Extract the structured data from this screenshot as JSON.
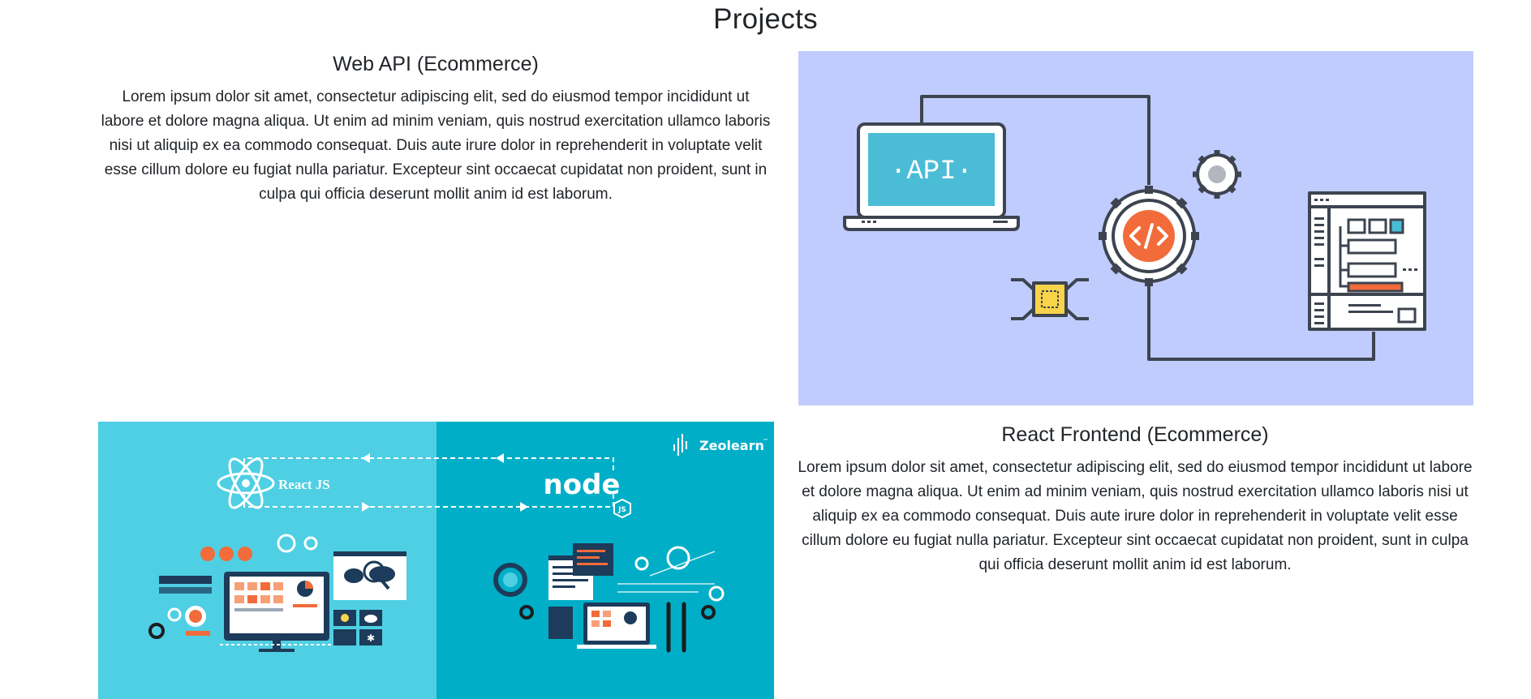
{
  "page": {
    "title": "Projects"
  },
  "projects": [
    {
      "title": "Web API (Ecommerce)",
      "description": "Lorem ipsum dolor sit amet, consectetur adipiscing elit, sed do eiusmod tempor incididunt ut labore et dolore magna aliqua. Ut enim ad minim veniam, quis nostrud exercitation ullamco laboris nisi ut aliquip ex ea commodo consequat. Duis aute irure dolor in reprehenderit in voluptate velit esse cillum dolore eu fugiat nulla pariatur. Excepteur sint occaecat cupidatat non proident, sunt in culpa qui officia deserunt mollit anim id est laborum.",
      "image_text": {
        "api": "·API·"
      }
    },
    {
      "title": "React Frontend (Ecommerce)",
      "description": "Lorem ipsum dolor sit amet, consectetur adipiscing elit, sed do eiusmod tempor incididunt ut labore et dolore magna aliqua. Ut enim ad minim veniam, quis nostrud exercitation ullamco laboris nisi ut aliquip ex ea commodo consequat. Duis aute irure dolor in reprehenderit in voluptate velit esse cillum dolore eu fugiat nulla pariatur. Excepteur sint occaecat cupidatat non proident, sunt in culpa qui officia deserunt mollit anim id est laborum.",
      "image_text": {
        "react": "React JS",
        "node": "node",
        "js_badge": "JS",
        "brand": "Zeolearn",
        "tm": "™"
      }
    }
  ],
  "colors": {
    "api_bg": "#c0ccfd",
    "line": "#3d4450",
    "screen": "#4bbcd6",
    "accent_orange": "#f26b3a",
    "chip_yellow": "#f9d44b",
    "react_left_bg": "#4fcfe3",
    "react_right_bg": "#00aec7"
  }
}
